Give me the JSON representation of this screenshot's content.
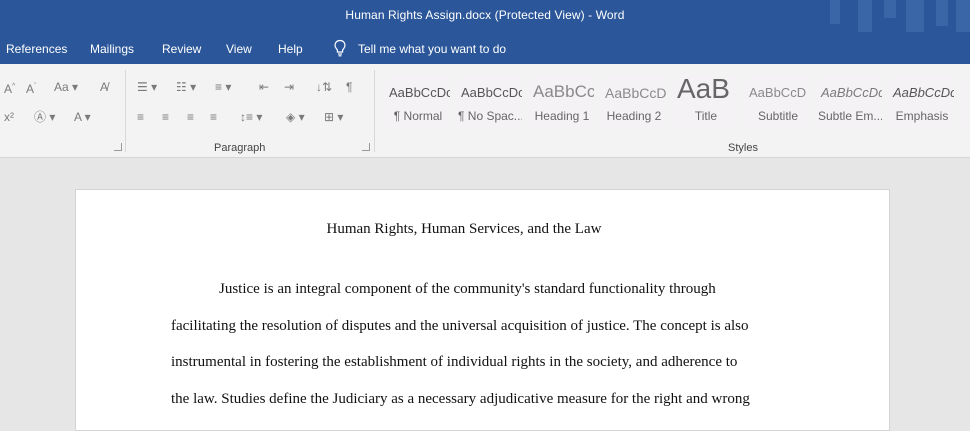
{
  "window": {
    "title": "Human Rights Assign.docx (Protected View)  -  Word"
  },
  "menu": {
    "tabs": [
      "References",
      "Mailings",
      "Review",
      "View",
      "Help"
    ],
    "tell_me": "Tell me what you want to do"
  },
  "ribbon": {
    "groups": {
      "paragraph": "Paragraph",
      "styles": "Styles"
    },
    "styles": [
      {
        "preview": "AaBbCcDc",
        "label": "¶ Normal"
      },
      {
        "preview": "AaBbCcDc",
        "label": "¶ No Spac..."
      },
      {
        "preview": "AaBbCc",
        "label": "Heading 1"
      },
      {
        "preview": "AaBbCcD",
        "label": "Heading 2"
      },
      {
        "preview": "AaB",
        "label": "Title"
      },
      {
        "preview": "AaBbCcD",
        "label": "Subtitle"
      },
      {
        "preview": "AaBbCcDc",
        "label": "Subtle Em..."
      },
      {
        "preview": "AaBbCcDc",
        "label": "Emphasis"
      }
    ]
  },
  "document": {
    "title": "Human Rights, Human Services, and the Law",
    "lines": [
      "Justice is an integral component of the community's standard functionality through",
      "facilitating the resolution of disputes and the universal acquisition of justice. The concept is also",
      "instrumental in fostering the establishment of individual rights in the society, and adherence to",
      "the law. Studies define the Judiciary as a necessary adjudicative measure for the right and wrong"
    ]
  }
}
